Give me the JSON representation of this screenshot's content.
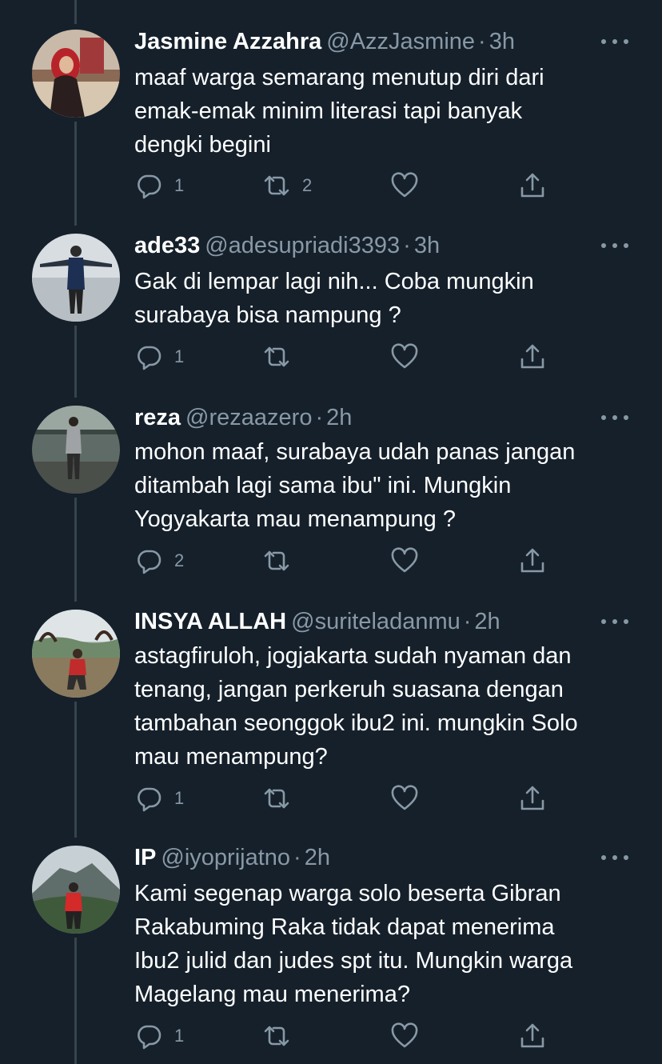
{
  "colors": {
    "background": "#15202b",
    "text": "#ffffff",
    "muted": "#8899a6",
    "thread_line": "#38444d"
  },
  "icons": {
    "reply": "reply-icon",
    "retweet": "retweet-icon",
    "like": "heart-icon",
    "share": "share-icon",
    "more": "more-icon"
  },
  "tweets": [
    {
      "name": "Jasmine Azzahra",
      "handle": "@AzzJasmine",
      "sep": "·",
      "time": "3h",
      "text": "maaf warga semarang menutup diri dari\nemak-emak minim literasi tapi banyak\ndengki begini",
      "replies": "1",
      "retweets": "2",
      "likes": ""
    },
    {
      "name": "ade33",
      "handle": "@adesupriadi3393",
      "sep": "·",
      "time": "3h",
      "text": "Gak di lempar lagi nih... Coba mungkin\nsurabaya bisa nampung ?",
      "replies": "1",
      "retweets": "",
      "likes": ""
    },
    {
      "name": "reza",
      "handle": "@rezaazero",
      "sep": "·",
      "time": "2h",
      "text": "mohon maaf, surabaya udah panas jangan\nditambah lagi sama ibu\" ini. Mungkin\nYogyakarta mau menampung ?",
      "replies": "2",
      "retweets": "",
      "likes": ""
    },
    {
      "name": "INSYA ALLAH",
      "handle": "@suriteladanmu",
      "sep": "·",
      "time": "2h",
      "text": "astagfiruloh, jogjakarta sudah nyaman dan\ntenang, jangan perkeruh suasana dengan\ntambahan seonggok ibu2 ini. mungkin Solo\nmau menampung?",
      "replies": "1",
      "retweets": "",
      "likes": ""
    },
    {
      "name": "IP",
      "handle": "@iyoprijatno",
      "sep": "·",
      "time": "2h",
      "text": "Kami segenap warga solo beserta Gibran\nRakabuming Raka tidak dapat menerima\nIbu2 julid dan judes spt itu. Mungkin warga\nMagelang mau menerima?",
      "replies": "1",
      "retweets": "",
      "likes": ""
    }
  ]
}
